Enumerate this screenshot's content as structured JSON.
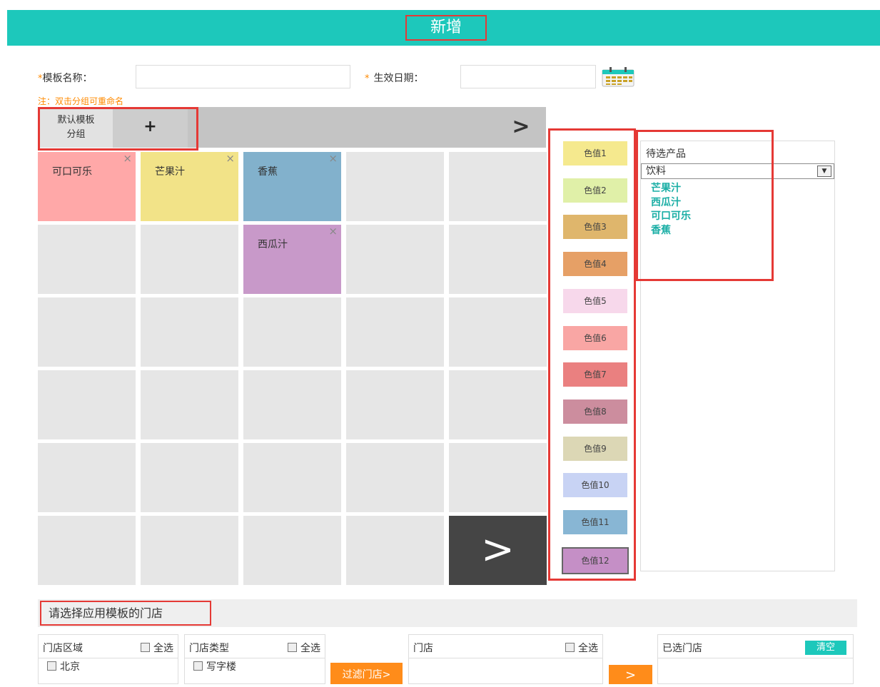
{
  "header": {
    "title": "新增"
  },
  "form": {
    "template_name_label": "模板名称：",
    "effective_date_label": "生效日期：",
    "required_mark": "*",
    "note": "注：双击分组可重命名"
  },
  "groups": {
    "default_group_line1": "默认模板",
    "default_group_line2": "分组",
    "add_label": "+",
    "next_label": ">"
  },
  "grid": {
    "next_label": ">",
    "items": [
      {
        "name": "可口可乐",
        "color": "#ffa8a8"
      },
      {
        "name": "芒果汁",
        "color": "#f2e388"
      },
      {
        "name": "香蕉",
        "color": "#82b1cc"
      },
      {
        "name": "西瓜汁",
        "color": "#c899c9"
      }
    ],
    "remove_label": "×"
  },
  "colors": {
    "swatches": [
      {
        "label": "色值1",
        "color": "#f5e98e"
      },
      {
        "label": "色值2",
        "color": "#e0f0a8"
      },
      {
        "label": "色值3",
        "color": "#dfb66c"
      },
      {
        "label": "色值4",
        "color": "#e6a066"
      },
      {
        "label": "色值5",
        "color": "#f7d8eb"
      },
      {
        "label": "色值6",
        "color": "#f9a6a4"
      },
      {
        "label": "色值7",
        "color": "#ea8080"
      },
      {
        "label": "色值8",
        "color": "#cc8d9e"
      },
      {
        "label": "色值9",
        "color": "#dcd7b5"
      },
      {
        "label": "色值10",
        "color": "#c8d3f4"
      },
      {
        "label": "色值11",
        "color": "#88b6d4"
      },
      {
        "label": "色值12",
        "color": "#c58fc6"
      }
    ]
  },
  "products": {
    "title": "待选产品",
    "category": "饮料",
    "items": [
      "芒果汁",
      "西瓜汁",
      "可口可乐",
      "香蕉"
    ]
  },
  "stores": {
    "title": "请选择应用模板的门店",
    "region_label": "门店区域",
    "type_label": "门店类型",
    "store_label": "门店",
    "selected_label": "已选门店",
    "select_all": "全选",
    "clear_label": "清空",
    "region_items": [
      "北京"
    ],
    "type_items": [
      "写字楼"
    ],
    "filter_button": "过滤门店>",
    "move_button": ">"
  }
}
